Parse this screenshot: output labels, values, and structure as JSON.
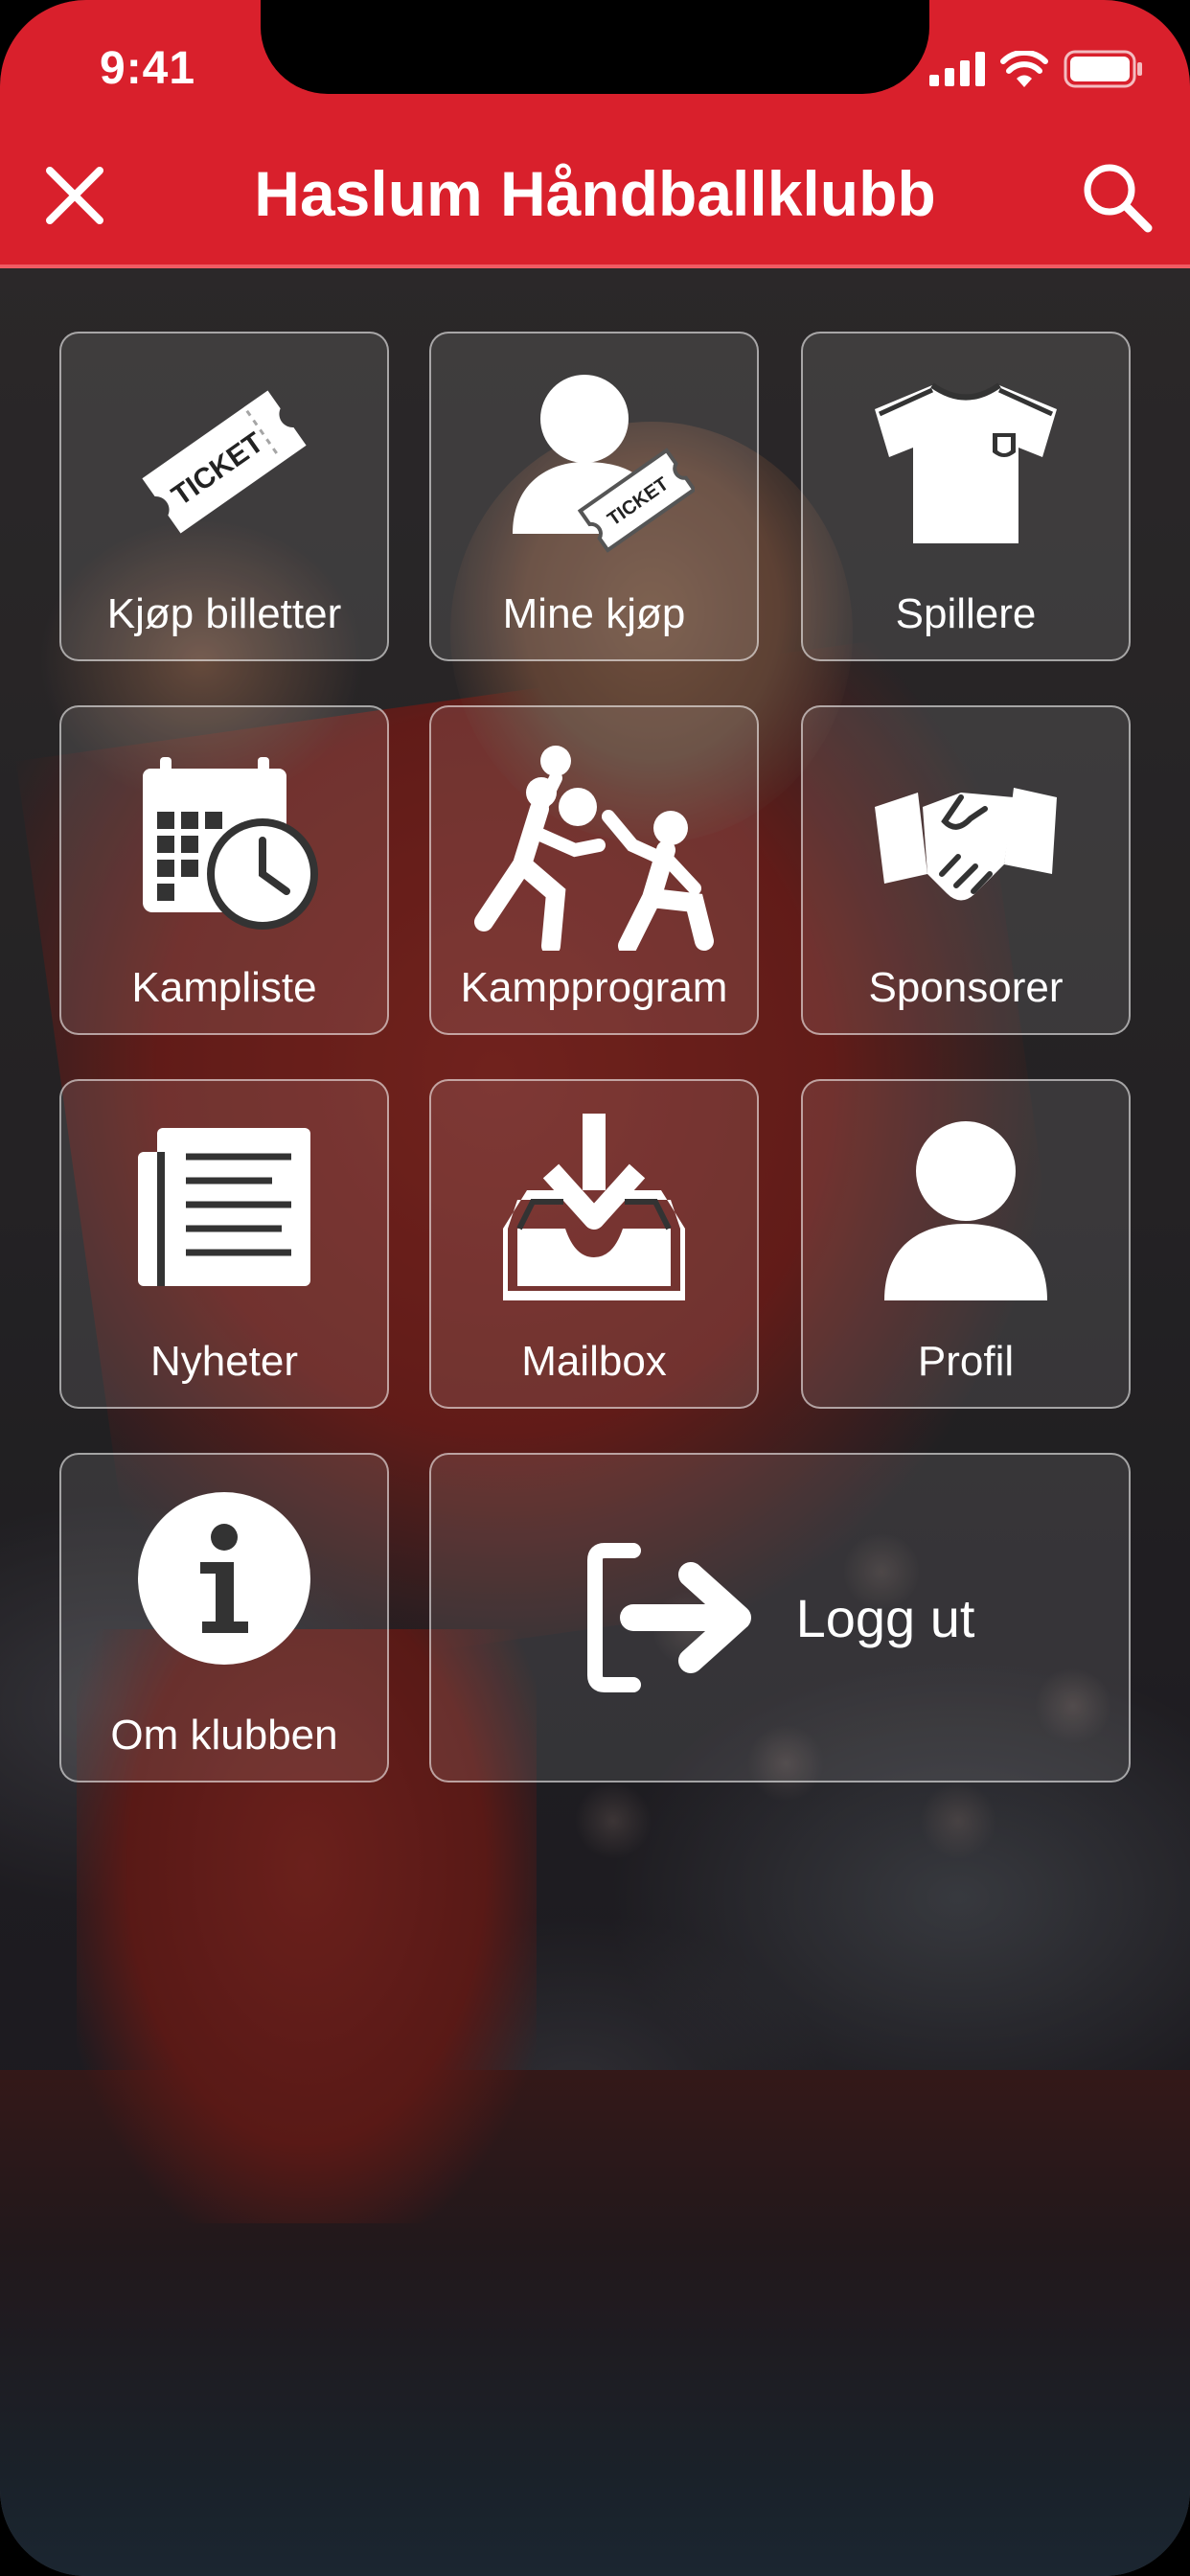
{
  "status_bar": {
    "time": "9:41"
  },
  "header": {
    "title": "Haslum Håndballklubb"
  },
  "menu": {
    "kjop_billetter": "Kjøp billetter",
    "ticket_text": "TICKET",
    "mine_kjop": "Mine kjøp",
    "spillere": "Spillere",
    "kampliste": "Kampliste",
    "kampprogram": "Kampprogram",
    "sponsorer": "Sponsorer",
    "nyheter": "Nyheter",
    "mailbox": "Mailbox",
    "profil": "Profil",
    "om_klubben": "Om klubben",
    "logg_ut": "Logg ut"
  },
  "colors": {
    "brand_red": "#d9202c"
  }
}
